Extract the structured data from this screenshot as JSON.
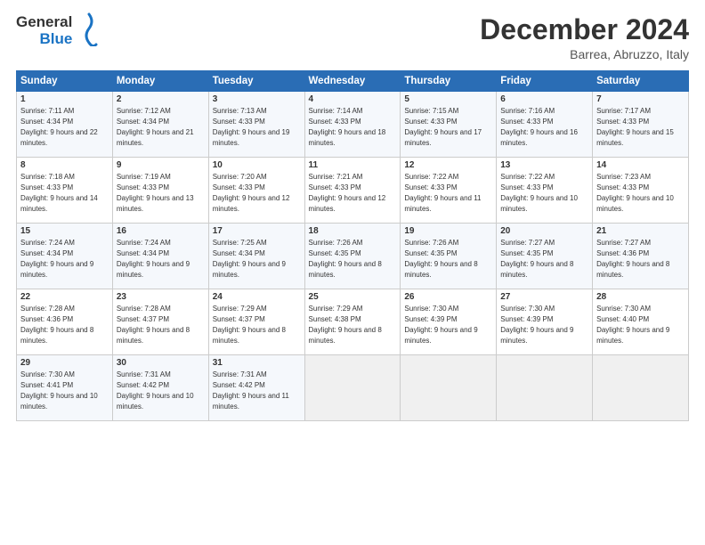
{
  "header": {
    "logo_line1": "General",
    "logo_line2": "Blue",
    "month": "December 2024",
    "location": "Barrea, Abruzzo, Italy"
  },
  "days_of_week": [
    "Sunday",
    "Monday",
    "Tuesday",
    "Wednesday",
    "Thursday",
    "Friday",
    "Saturday"
  ],
  "weeks": [
    [
      {
        "day": "1",
        "sunrise": "7:11 AM",
        "sunset": "4:34 PM",
        "daylight": "9 hours and 22 minutes."
      },
      {
        "day": "2",
        "sunrise": "7:12 AM",
        "sunset": "4:34 PM",
        "daylight": "9 hours and 21 minutes."
      },
      {
        "day": "3",
        "sunrise": "7:13 AM",
        "sunset": "4:33 PM",
        "daylight": "9 hours and 19 minutes."
      },
      {
        "day": "4",
        "sunrise": "7:14 AM",
        "sunset": "4:33 PM",
        "daylight": "9 hours and 18 minutes."
      },
      {
        "day": "5",
        "sunrise": "7:15 AM",
        "sunset": "4:33 PM",
        "daylight": "9 hours and 17 minutes."
      },
      {
        "day": "6",
        "sunrise": "7:16 AM",
        "sunset": "4:33 PM",
        "daylight": "9 hours and 16 minutes."
      },
      {
        "day": "7",
        "sunrise": "7:17 AM",
        "sunset": "4:33 PM",
        "daylight": "9 hours and 15 minutes."
      }
    ],
    [
      {
        "day": "8",
        "sunrise": "7:18 AM",
        "sunset": "4:33 PM",
        "daylight": "9 hours and 14 minutes."
      },
      {
        "day": "9",
        "sunrise": "7:19 AM",
        "sunset": "4:33 PM",
        "daylight": "9 hours and 13 minutes."
      },
      {
        "day": "10",
        "sunrise": "7:20 AM",
        "sunset": "4:33 PM",
        "daylight": "9 hours and 12 minutes."
      },
      {
        "day": "11",
        "sunrise": "7:21 AM",
        "sunset": "4:33 PM",
        "daylight": "9 hours and 12 minutes."
      },
      {
        "day": "12",
        "sunrise": "7:22 AM",
        "sunset": "4:33 PM",
        "daylight": "9 hours and 11 minutes."
      },
      {
        "day": "13",
        "sunrise": "7:22 AM",
        "sunset": "4:33 PM",
        "daylight": "9 hours and 10 minutes."
      },
      {
        "day": "14",
        "sunrise": "7:23 AM",
        "sunset": "4:33 PM",
        "daylight": "9 hours and 10 minutes."
      }
    ],
    [
      {
        "day": "15",
        "sunrise": "7:24 AM",
        "sunset": "4:34 PM",
        "daylight": "9 hours and 9 minutes."
      },
      {
        "day": "16",
        "sunrise": "7:24 AM",
        "sunset": "4:34 PM",
        "daylight": "9 hours and 9 minutes."
      },
      {
        "day": "17",
        "sunrise": "7:25 AM",
        "sunset": "4:34 PM",
        "daylight": "9 hours and 9 minutes."
      },
      {
        "day": "18",
        "sunrise": "7:26 AM",
        "sunset": "4:35 PM",
        "daylight": "9 hours and 8 minutes."
      },
      {
        "day": "19",
        "sunrise": "7:26 AM",
        "sunset": "4:35 PM",
        "daylight": "9 hours and 8 minutes."
      },
      {
        "day": "20",
        "sunrise": "7:27 AM",
        "sunset": "4:35 PM",
        "daylight": "9 hours and 8 minutes."
      },
      {
        "day": "21",
        "sunrise": "7:27 AM",
        "sunset": "4:36 PM",
        "daylight": "9 hours and 8 minutes."
      }
    ],
    [
      {
        "day": "22",
        "sunrise": "7:28 AM",
        "sunset": "4:36 PM",
        "daylight": "9 hours and 8 minutes."
      },
      {
        "day": "23",
        "sunrise": "7:28 AM",
        "sunset": "4:37 PM",
        "daylight": "9 hours and 8 minutes."
      },
      {
        "day": "24",
        "sunrise": "7:29 AM",
        "sunset": "4:37 PM",
        "daylight": "9 hours and 8 minutes."
      },
      {
        "day": "25",
        "sunrise": "7:29 AM",
        "sunset": "4:38 PM",
        "daylight": "9 hours and 8 minutes."
      },
      {
        "day": "26",
        "sunrise": "7:30 AM",
        "sunset": "4:39 PM",
        "daylight": "9 hours and 9 minutes."
      },
      {
        "day": "27",
        "sunrise": "7:30 AM",
        "sunset": "4:39 PM",
        "daylight": "9 hours and 9 minutes."
      },
      {
        "day": "28",
        "sunrise": "7:30 AM",
        "sunset": "4:40 PM",
        "daylight": "9 hours and 9 minutes."
      }
    ],
    [
      {
        "day": "29",
        "sunrise": "7:30 AM",
        "sunset": "4:41 PM",
        "daylight": "9 hours and 10 minutes."
      },
      {
        "day": "30",
        "sunrise": "7:31 AM",
        "sunset": "4:42 PM",
        "daylight": "9 hours and 10 minutes."
      },
      {
        "day": "31",
        "sunrise": "7:31 AM",
        "sunset": "4:42 PM",
        "daylight": "9 hours and 11 minutes."
      },
      null,
      null,
      null,
      null
    ]
  ]
}
